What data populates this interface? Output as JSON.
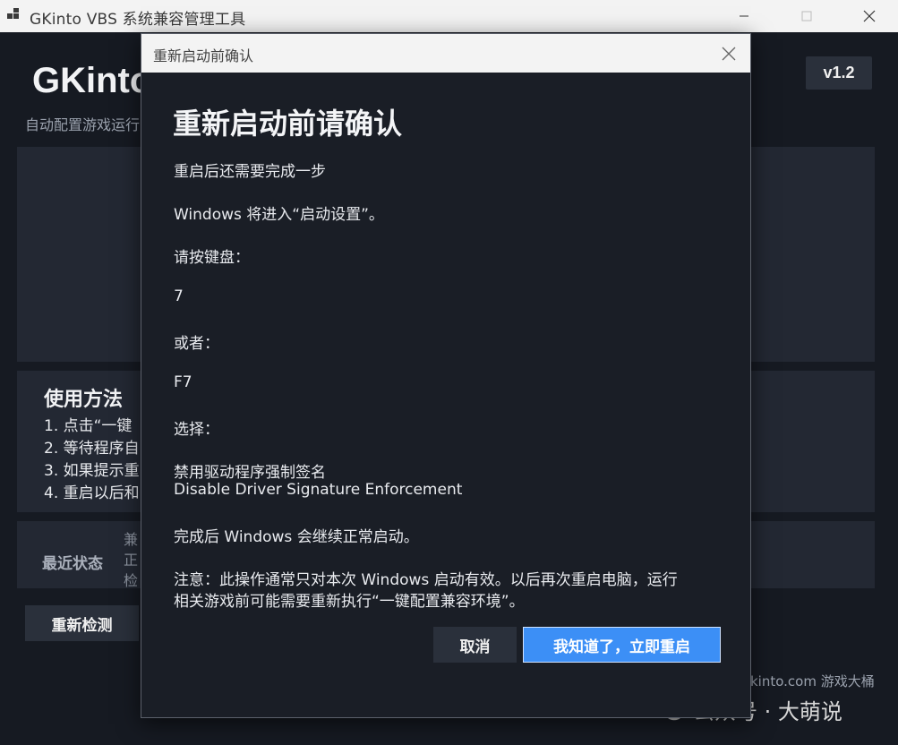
{
  "window": {
    "title": "GKinto VBS 系统兼容管理工具",
    "app_icon": "app-icon"
  },
  "app": {
    "title": "GKinto",
    "subtitle": "自动配置游戏运行",
    "version": "v1.2"
  },
  "usage": {
    "title": "使用方法",
    "items": [
      "1.  点击“一键",
      "2.  等待程序自",
      "3.  如果提示重",
      "4.  重启以后和"
    ]
  },
  "status": {
    "label": "最近状态",
    "lines": [
      "兼",
      "正",
      "检"
    ]
  },
  "recheck_label": "重新检测",
  "footer_link": "kinto.com 游戏大桶",
  "watermark": {
    "text": "公众号 · 大萌说",
    "icon": "wechat-icon"
  },
  "dialog": {
    "title": "重新启动前确认",
    "heading": "重新启动前请确认",
    "lines": [
      "重启后还需要完成一步",
      "Windows 将进入“启动设置”。",
      "请按键盘：",
      "7",
      "或者：",
      "F7",
      "选择：",
      "禁用驱动程序强制签名",
      "Disable Driver Signature Enforcement",
      "完成后 Windows 会继续正常启动。",
      "注意：此操作通常只对本次 Windows 启动有效。以后再次重启电脑，运行",
      "相关游戏前可能需要重新执行“一键配置兼容环境”。"
    ],
    "cancel_label": "取消",
    "confirm_label": "我知道了，立即重启"
  },
  "colors": {
    "background": "#161a22",
    "panel": "#232833",
    "accent": "#3c8ff6",
    "titlebar": "#f3f3f3"
  }
}
